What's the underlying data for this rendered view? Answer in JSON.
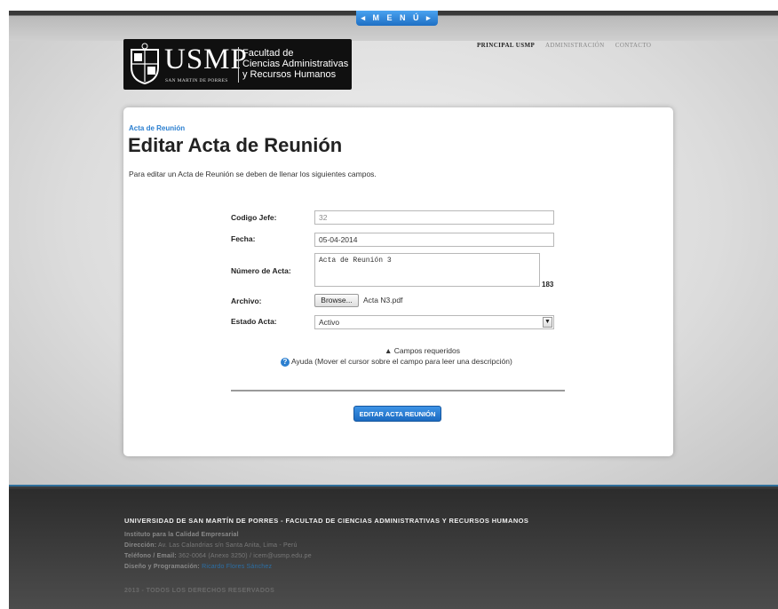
{
  "menu": {
    "label": "◂ M E N Ú ▸"
  },
  "logo": {
    "brand": "USMP",
    "subtitle": "SAN MARTIN DE PORRES",
    "faculty_line1": "Facultad de",
    "faculty_line2": "Ciencias Administrativas",
    "faculty_line3": "y Recursos Humanos"
  },
  "topnav": {
    "items": [
      "PRINCIPAL USMP",
      "ADMINISTRACIÓN",
      "CONTACTO"
    ]
  },
  "form": {
    "breadcrumb": "Acta de Reunión",
    "title": "Editar Acta de Reunión",
    "intro": "Para editar un Acta de Reunión se deben de llenar los siguientes campos.",
    "codigo_label": "Codigo Jefe:",
    "codigo_value": "32",
    "fecha_label": "Fecha:",
    "fecha_value": "05-04-2014",
    "numero_label": "Número de Acta:",
    "numero_value": "Acta de Reunión 3",
    "numero_counter": "183",
    "archivo_label": "Archivo:",
    "browse_label": "Browse...",
    "archivo_value": "Acta N3.pdf",
    "estado_label": "Estado Acta:",
    "estado_value": "Activo",
    "required_note": "▲ Campos requeridos",
    "help_note": "Ayuda (Mover el cursor sobre el campo para leer una descripción)",
    "submit_label": "EDITAR ACTA REUNIÓN"
  },
  "footer": {
    "title": "UNIVERSIDAD DE SAN MARTÍN DE PORRES - FACULTAD DE CIENCIAS ADMINISTRATIVAS Y RECURSOS HUMANOS",
    "institute": "Instituto para la Calidad Empresarial",
    "address_label": "Dirección:",
    "address_value": "Av. Las Calandrias s/n Santa Anita, Lima - Perú",
    "phone_label": "Teléfono / Email:",
    "phone_value": "362-0064 (Anexo 3250) / icem@usmp.edu.pe",
    "design_label": "Diseño y Programación:",
    "design_value": "Ricardo Flores Sánchez",
    "copyright": "2013 - TODOS LOS DERECHOS RESERVADOS"
  }
}
